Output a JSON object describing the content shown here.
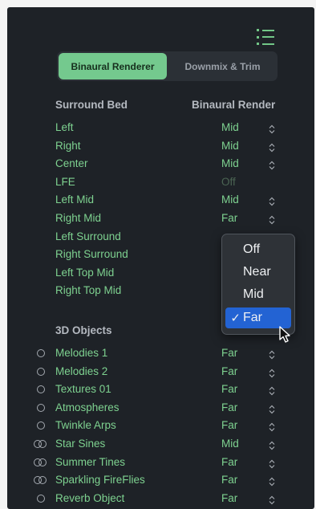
{
  "toolbar": {
    "menu_icon": "list-icon"
  },
  "tabs": [
    {
      "label": "Binaural Renderer",
      "active": true
    },
    {
      "label": "Downmix & Trim",
      "active": false
    }
  ],
  "surround": {
    "header": "Surround Bed",
    "value_header": "Binaural Render",
    "rows": [
      {
        "label": "Left",
        "value": "Mid"
      },
      {
        "label": "Right",
        "value": "Mid"
      },
      {
        "label": "Center",
        "value": "Mid"
      },
      {
        "label": "LFE",
        "value": "Off"
      },
      {
        "label": "Left Mid",
        "value": "Mid"
      },
      {
        "label": "Right Mid",
        "value": "Far"
      },
      {
        "label": "Left Surround",
        "value": ""
      },
      {
        "label": "Right Surround",
        "value": ""
      },
      {
        "label": "Left Top Mid",
        "value": ""
      },
      {
        "label": "Right Top Mid",
        "value": ""
      }
    ]
  },
  "objects": {
    "header": "3D Objects",
    "rows": [
      {
        "label": "Melodies 1",
        "value": "Far",
        "icon": "mono-object-icon"
      },
      {
        "label": "Melodies 2",
        "value": "Far",
        "icon": "mono-object-icon"
      },
      {
        "label": "Textures 01",
        "value": "Far",
        "icon": "mono-object-icon"
      },
      {
        "label": "Atmospheres",
        "value": "Far",
        "icon": "mono-object-icon"
      },
      {
        "label": "Twinkle Arps",
        "value": "Far",
        "icon": "mono-object-icon"
      },
      {
        "label": "Star Sines",
        "value": "Mid",
        "icon": "stereo-object-icon"
      },
      {
        "label": "Summer Tines",
        "value": "Far",
        "icon": "stereo-object-icon"
      },
      {
        "label": "Sparkling FireFlies",
        "value": "Far",
        "icon": "stereo-object-icon"
      },
      {
        "label": "Reverb Object",
        "value": "Far",
        "icon": "mono-object-icon"
      }
    ]
  },
  "dropdown": {
    "options": [
      "Off",
      "Near",
      "Mid",
      "Far"
    ],
    "selected": "Far",
    "check": "✓"
  },
  "colors": {
    "accent": "#74c98e",
    "selection": "#2363d3",
    "background": "#1e2227"
  }
}
